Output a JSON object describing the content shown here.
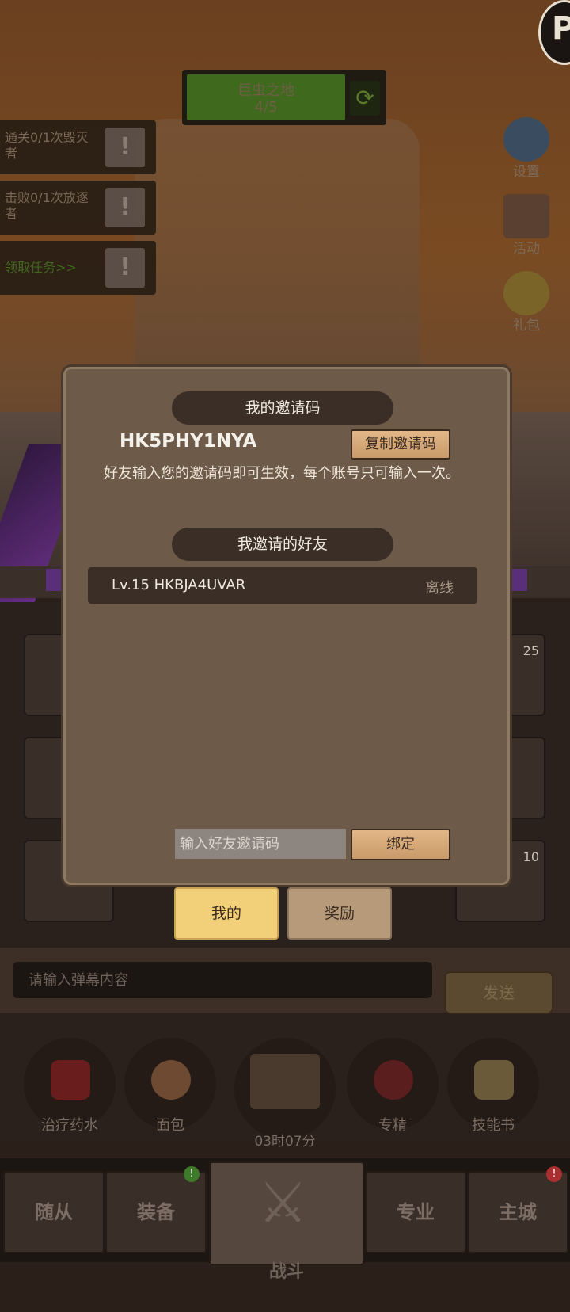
{
  "stage": {
    "title": "巨虫之地",
    "progress": "4/5"
  },
  "quests": [
    {
      "label": "通关0/1次毁灭者"
    },
    {
      "label": "击败0/1次放逐者"
    },
    {
      "label": "领取任务>>"
    }
  ],
  "side_menu": [
    {
      "label": "设置",
      "icon": "gear-icon"
    },
    {
      "label": "活动",
      "icon": "scroll-icon"
    },
    {
      "label": "礼包",
      "icon": "gift-bag-icon"
    }
  ],
  "inventory": {
    "counts": [
      "25",
      "10"
    ]
  },
  "dialog": {
    "invite_banner": "我的邀请码",
    "invite_code": "HK5PHY1NYA",
    "copy_button": "复制邀请码",
    "hint": "好友输入您的邀请码即可生效，每个账号只可输入一次。",
    "friends_banner": "我邀请的好友",
    "friends": [
      {
        "name": "Lv.15 HKBJA4UVAR",
        "status": "离线"
      }
    ],
    "input_placeholder": "输入好友邀请码",
    "bind_button": "绑定"
  },
  "tabs": [
    {
      "label": "我的",
      "active": true
    },
    {
      "label": "奖励",
      "active": false
    }
  ],
  "chat": {
    "placeholder": "请输入弹幕内容",
    "send_label": "发送"
  },
  "items": [
    {
      "label": "治疗药水"
    },
    {
      "label": "面包"
    },
    {
      "label": "专精"
    },
    {
      "label": "技能书"
    }
  ],
  "chest_timer": "03时07分",
  "nav": {
    "companions": "随从",
    "equipment": "装备",
    "battle": "战斗",
    "profession": "专业",
    "main_city": "主城",
    "equipment_badge": "!",
    "main_city_badge": "!"
  },
  "colors": {
    "accent_active_tab": "#f2d07a",
    "wood_button": "#d9aa78",
    "dialog_bg": "#6e5a48"
  }
}
